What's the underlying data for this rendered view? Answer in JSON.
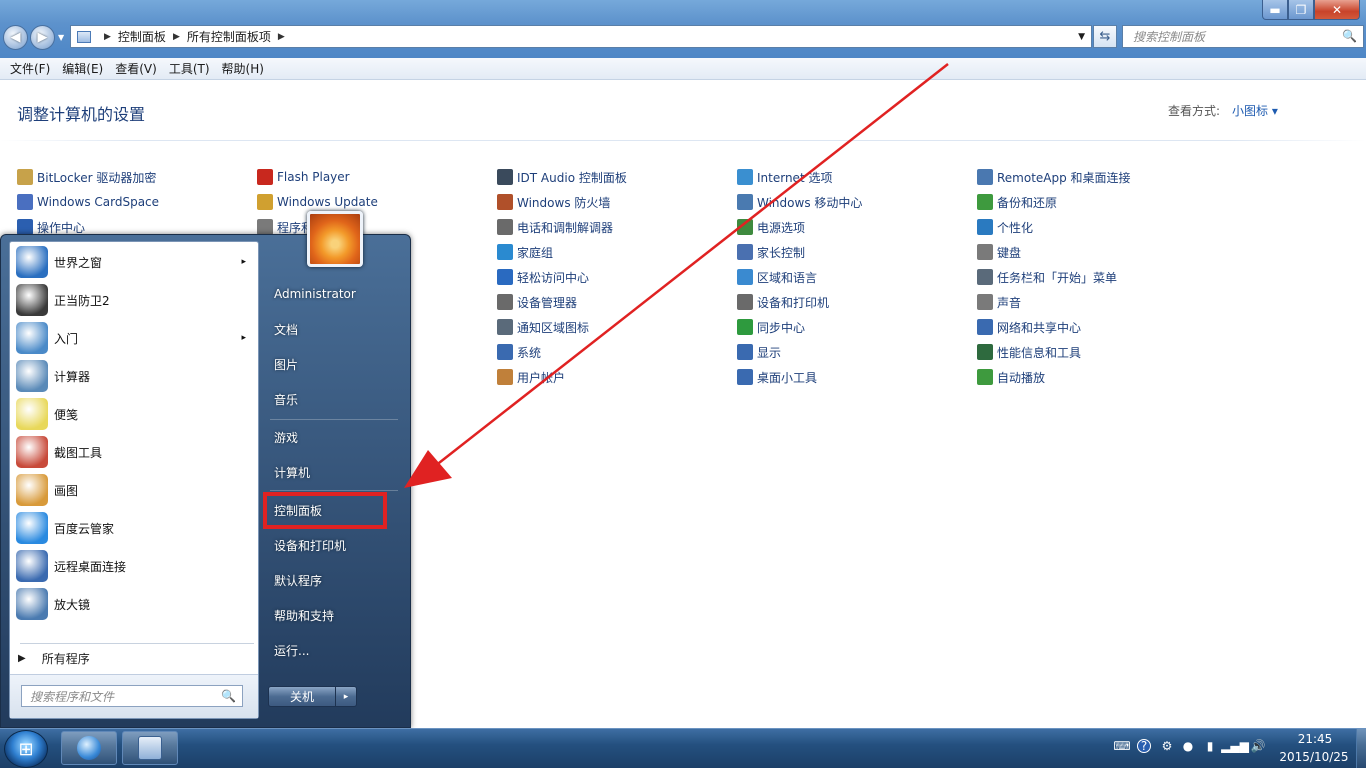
{
  "window": {
    "breadcrumb": [
      "控制面板",
      "所有控制面板项"
    ],
    "search_placeholder": "搜索控制面板",
    "minimize": "▬",
    "maximize": "❐",
    "close": "✕"
  },
  "menubar": [
    "文件(F)",
    "编辑(E)",
    "查看(V)",
    "工具(T)",
    "帮助(H)"
  ],
  "content": {
    "page_title": "调整计算机的设置",
    "view_label": "查看方式:",
    "view_value": "小图标 ▾",
    "items": [
      {
        "label": "BitLocker 驱动器加密",
        "icon": "bitlocker-icon",
        "color": "#c7a24a"
      },
      {
        "label": "Flash Player",
        "icon": "flash-icon",
        "color": "#c8281e"
      },
      {
        "label": "IDT Audio 控制面板",
        "icon": "audio-icon",
        "color": "#3a4a5c"
      },
      {
        "label": "Internet 选项",
        "icon": "internet-icon",
        "color": "#3a8fd0"
      },
      {
        "label": "RemoteApp 和桌面连接",
        "icon": "remoteapp-icon",
        "color": "#4a78b0"
      },
      {
        "label": "Windows CardSpace",
        "icon": "cardspace-icon",
        "color": "#4a6fc0"
      },
      {
        "label": "Windows Update",
        "icon": "update-icon",
        "color": "#d0a030"
      },
      {
        "label": "Windows 防火墙",
        "icon": "firewall-icon",
        "color": "#b0502a"
      },
      {
        "label": "Windows 移动中心",
        "icon": "mobility-icon",
        "color": "#4a7ab0"
      },
      {
        "label": "备份和还原",
        "icon": "backup-icon",
        "color": "#3e9a3e"
      },
      {
        "label": "操作中心",
        "icon": "flag-icon",
        "color": "#2b5fb0"
      },
      {
        "label": "程序和功能",
        "icon": "programs-icon",
        "color": "#7a7a7a"
      },
      {
        "label": "电话和调制解调器",
        "icon": "phone-icon",
        "color": "#6a6a6a"
      },
      {
        "label": "电源选项",
        "icon": "power-icon",
        "color": "#3e8a3e"
      },
      {
        "label": "个性化",
        "icon": "personalize-icon",
        "color": "#2a7ac0"
      },
      {
        "label": "",
        "icon": "blank-icon",
        "color": "#cfd6de"
      },
      {
        "label": "",
        "icon": "blank-icon",
        "color": "#cfd6de"
      },
      {
        "label": "家庭组",
        "icon": "homegroup-icon",
        "color": "#2a8ad0"
      },
      {
        "label": "家长控制",
        "icon": "parental-icon",
        "color": "#4a70b0"
      },
      {
        "label": "键盘",
        "icon": "keyboard-icon",
        "color": "#7a7a7a"
      },
      {
        "label": "",
        "icon": "blank-icon",
        "color": "#cfd6de"
      },
      {
        "label": "",
        "icon": "blank-icon",
        "color": "#cfd6de"
      },
      {
        "label": "轻松访问中心",
        "icon": "ease-icon",
        "color": "#2a6ac0"
      },
      {
        "label": "区域和语言",
        "icon": "region-icon",
        "color": "#3a8ad0"
      },
      {
        "label": "任务栏和「开始」菜单",
        "icon": "taskbar-icon",
        "color": "#5a6a7a"
      },
      {
        "label": "",
        "icon": "blank-icon",
        "color": "#cfd6de"
      },
      {
        "label": "",
        "icon": "blank-icon",
        "color": "#cfd6de"
      },
      {
        "label": "设备管理器",
        "icon": "devmgr-icon",
        "color": "#6a6a6a"
      },
      {
        "label": "设备和打印机",
        "icon": "printer-icon",
        "color": "#6a6a6a"
      },
      {
        "label": "声音",
        "icon": "sound-icon",
        "color": "#7a7a7a"
      },
      {
        "label": "",
        "icon": "blank-icon",
        "color": "#cfd6de"
      },
      {
        "label": "",
        "icon": "blank-icon",
        "color": "#cfd6de"
      },
      {
        "label": "通知区域图标",
        "icon": "notify-icon",
        "color": "#5a6a7a"
      },
      {
        "label": "同步中心",
        "icon": "sync-icon",
        "color": "#2e9a3e"
      },
      {
        "label": "网络和共享中心",
        "icon": "network-icon",
        "color": "#3a6ab0"
      },
      {
        "label": "",
        "icon": "blank-icon",
        "color": "#cfd6de"
      },
      {
        "label": "",
        "icon": "blank-icon",
        "color": "#cfd6de"
      },
      {
        "label": "系统",
        "icon": "system-icon",
        "color": "#3a6ab0"
      },
      {
        "label": "显示",
        "icon": "display-icon",
        "color": "#3a6ab0"
      },
      {
        "label": "性能信息和工具",
        "icon": "performance-icon",
        "color": "#2e6a3e"
      },
      {
        "label": "",
        "icon": "blank-icon",
        "color": "#cfd6de"
      },
      {
        "label": "",
        "icon": "blank-icon",
        "color": "#cfd6de"
      },
      {
        "label": "用户帐户",
        "icon": "users-icon",
        "color": "#c0803a"
      },
      {
        "label": "桌面小工具",
        "icon": "gadgets-icon",
        "color": "#3a6ab0"
      },
      {
        "label": "自动播放",
        "icon": "autoplay-icon",
        "color": "#3e9a3e"
      }
    ]
  },
  "startmenu": {
    "programs": [
      {
        "label": "世界之窗",
        "icon": "browser-globe-icon",
        "color": "#2a6fc0",
        "arrow": "▸"
      },
      {
        "label": "正当防卫2",
        "icon": "game-scorpion-icon",
        "color": "#3a3a3a",
        "arrow": ""
      },
      {
        "label": "入门",
        "icon": "getting-started-icon",
        "color": "#4a8ac8",
        "arrow": "▸"
      },
      {
        "label": "计算器",
        "icon": "calculator-icon",
        "color": "#5a8ab8",
        "arrow": ""
      },
      {
        "label": "便笺",
        "icon": "sticky-notes-icon",
        "color": "#e8d85a",
        "arrow": ""
      },
      {
        "label": "截图工具",
        "icon": "scissors-icon",
        "color": "#c84a3a",
        "arrow": ""
      },
      {
        "label": "画图",
        "icon": "paint-palette-icon",
        "color": "#d89a3a",
        "arrow": ""
      },
      {
        "label": "百度云管家",
        "icon": "baidu-cloud-icon",
        "color": "#2a8ae0",
        "arrow": ""
      },
      {
        "label": "远程桌面连接",
        "icon": "remote-desktop-icon",
        "color": "#3a6ab0",
        "arrow": ""
      },
      {
        "label": "放大镜",
        "icon": "magnifier-icon",
        "color": "#4a7ab0",
        "arrow": ""
      }
    ],
    "all_programs": "所有程序",
    "search_placeholder": "搜索程序和文件",
    "right_items": [
      "Administrator",
      "文档",
      "图片",
      "音乐",
      "游戏",
      "计算机",
      "控制面板",
      "设备和打印机",
      "默认程序",
      "帮助和支持",
      "运行..."
    ],
    "shutdown": "关机",
    "shutdown_arrow": "▸"
  },
  "taskbar": {
    "time": "21:45",
    "date": "2015/10/25"
  },
  "colors": {
    "highlight": "#e02222",
    "arrow": "#e02222"
  }
}
